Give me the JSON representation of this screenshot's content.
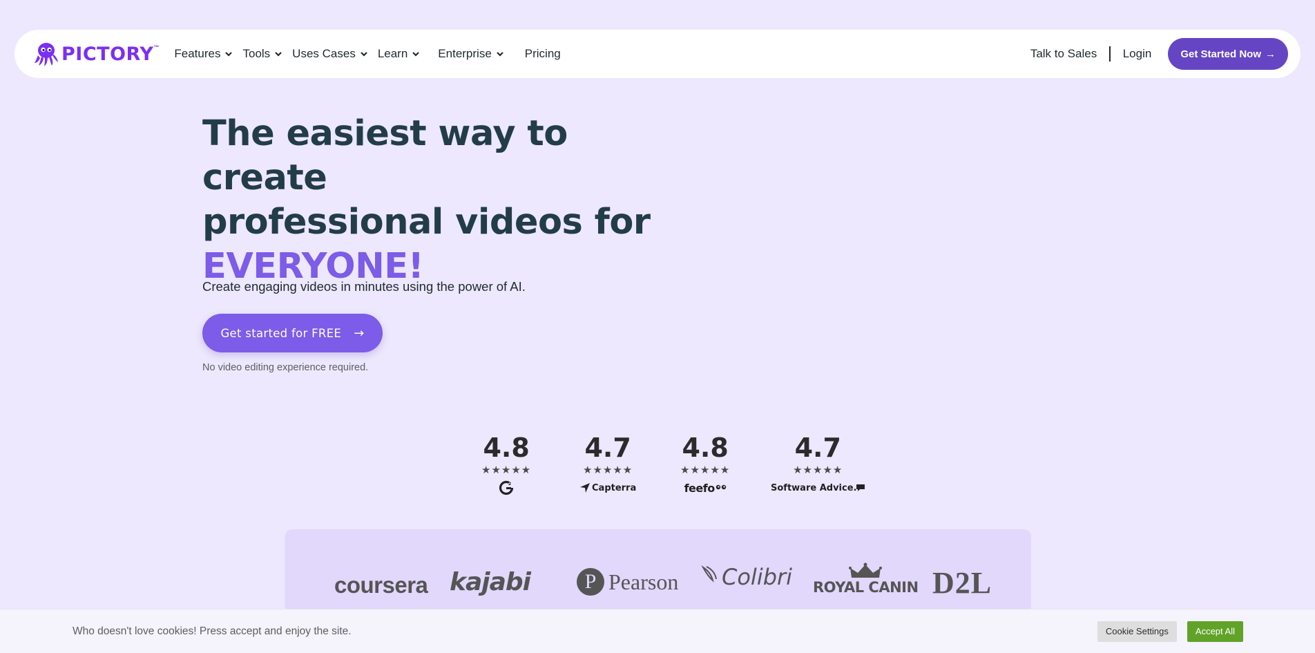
{
  "nav": {
    "logo_text": "PICTORY",
    "logo_tm": "™",
    "items": [
      {
        "label": "Features"
      },
      {
        "label": "Tools"
      },
      {
        "label": "Uses Cases"
      },
      {
        "label": "Learn"
      },
      {
        "label": "Enterprise"
      }
    ],
    "pricing": "Pricing",
    "talk_to_sales": "Talk to Sales",
    "login": "Login",
    "cta": "Get Started Now",
    "cta_arrow": "→"
  },
  "hero": {
    "title_line1": "The easiest way to create",
    "title_line2": "professional videos for",
    "title_accent": "EVERYONE!",
    "subtitle": "Create engaging videos in minutes using the power of AI.",
    "cta": "Get started for FREE",
    "cta_arrow": "→",
    "note": "No video editing experience required."
  },
  "ratings": [
    {
      "score": "4.8",
      "stars": "★★★★★",
      "brand": "G2"
    },
    {
      "score": "4.7",
      "stars": "★★★★★",
      "brand": "Capterra"
    },
    {
      "score": "4.8",
      "stars": "★★★★★",
      "brand": "feefo"
    },
    {
      "score": "4.7",
      "stars": "★★★★★",
      "brand": "Software Advice."
    }
  ],
  "clients": {
    "coursera": "coursera",
    "kajabi": "kajabi",
    "pearson": "Pearson",
    "colibri": "Colibri",
    "royal_canin": "ROYAL CANIN",
    "d2l": "D2L"
  },
  "cookie": {
    "text": "Who doesn't love cookies! Press accept and enjoy the site.",
    "settings": "Cookie Settings",
    "accept": "Accept All"
  },
  "colors": {
    "background": "#ede8fd",
    "brand_purple": "#7b2ff2",
    "accent": "#7c5ce8",
    "nav_button": "#6645c4",
    "accept_green": "#61a229"
  }
}
